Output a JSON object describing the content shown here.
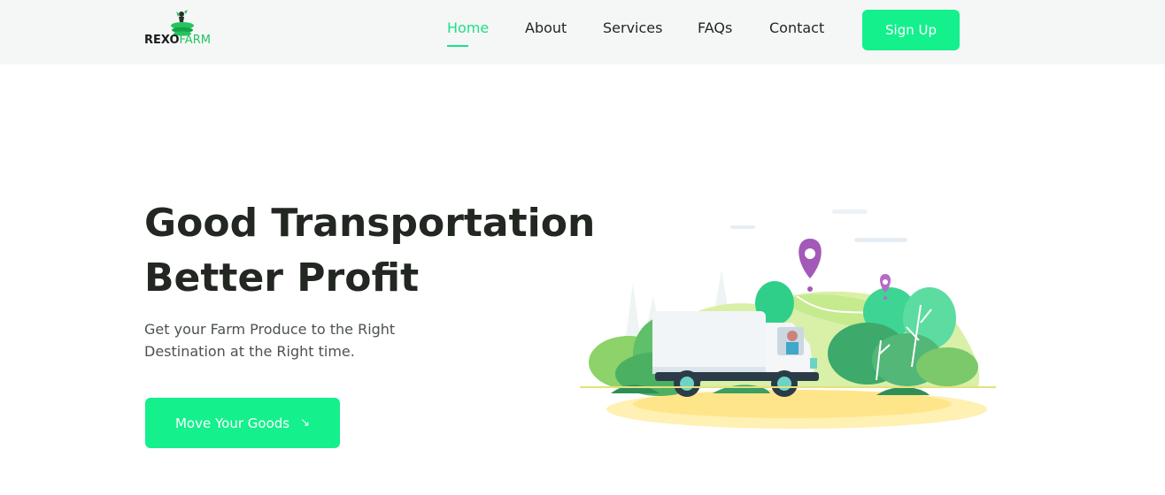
{
  "header": {
    "logo": {
      "part1": "REXO",
      "part2": "FARM",
      "icon": "farmer-leaf-icon"
    },
    "nav": [
      {
        "label": "Home",
        "active": true
      },
      {
        "label": "About",
        "active": false
      },
      {
        "label": "Services",
        "active": false
      },
      {
        "label": "FAQs",
        "active": false
      },
      {
        "label": "Contact",
        "active": false
      }
    ],
    "signup_label": "Sign Up"
  },
  "hero": {
    "title_line1": "Good Transportation",
    "title_line2": "Better Profit",
    "subtitle": "Get your Farm Produce to the Right Destination at the Right time.",
    "cta_label": "Move Your Goods",
    "cta_icon": "arrow-down-right-icon",
    "illustration": "delivery-truck-illustration"
  },
  "colors": {
    "accent": "#13f08c",
    "nav_active": "#1ee08a",
    "header_bg": "#f5f7f6",
    "text": "#222722"
  }
}
